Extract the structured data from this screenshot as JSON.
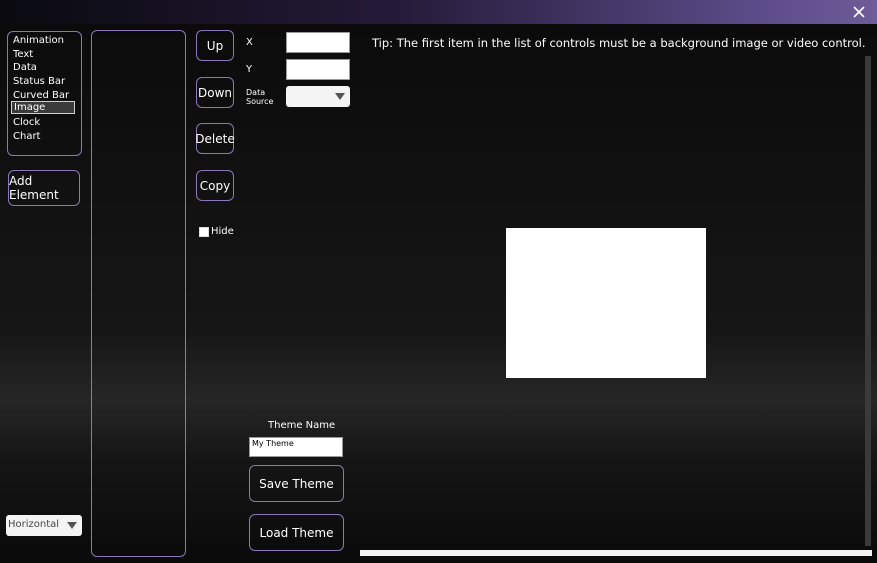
{
  "titlebar": {
    "close_icon": "close-icon"
  },
  "element_list": {
    "items": [
      "Animation",
      "Text",
      "Data",
      "Status Bar",
      "Curved Bar",
      "Image",
      "Clock",
      "Chart"
    ],
    "selected_index": 5
  },
  "buttons": {
    "add_element": "Add Element",
    "up": "Up",
    "down": "Down",
    "delete": "Delete",
    "copy": "Copy",
    "save_theme": "Save Theme",
    "load_theme": "Load Theme"
  },
  "hide": {
    "label": "Hide",
    "checked": false
  },
  "properties": {
    "x_label": "X",
    "y_label": "Y",
    "data_source_label": "Data Source",
    "x_value": "",
    "y_value": "",
    "data_source_value": ""
  },
  "orientation": {
    "value": "Horizontal"
  },
  "theme": {
    "name_label": "Theme Name",
    "name_value": "My Theme"
  },
  "tip": "Tip: The first item in the list of controls must be a background image or video control.",
  "colors": {
    "accent": "#8a78b8",
    "titlebar_end": "#6e5c99"
  }
}
